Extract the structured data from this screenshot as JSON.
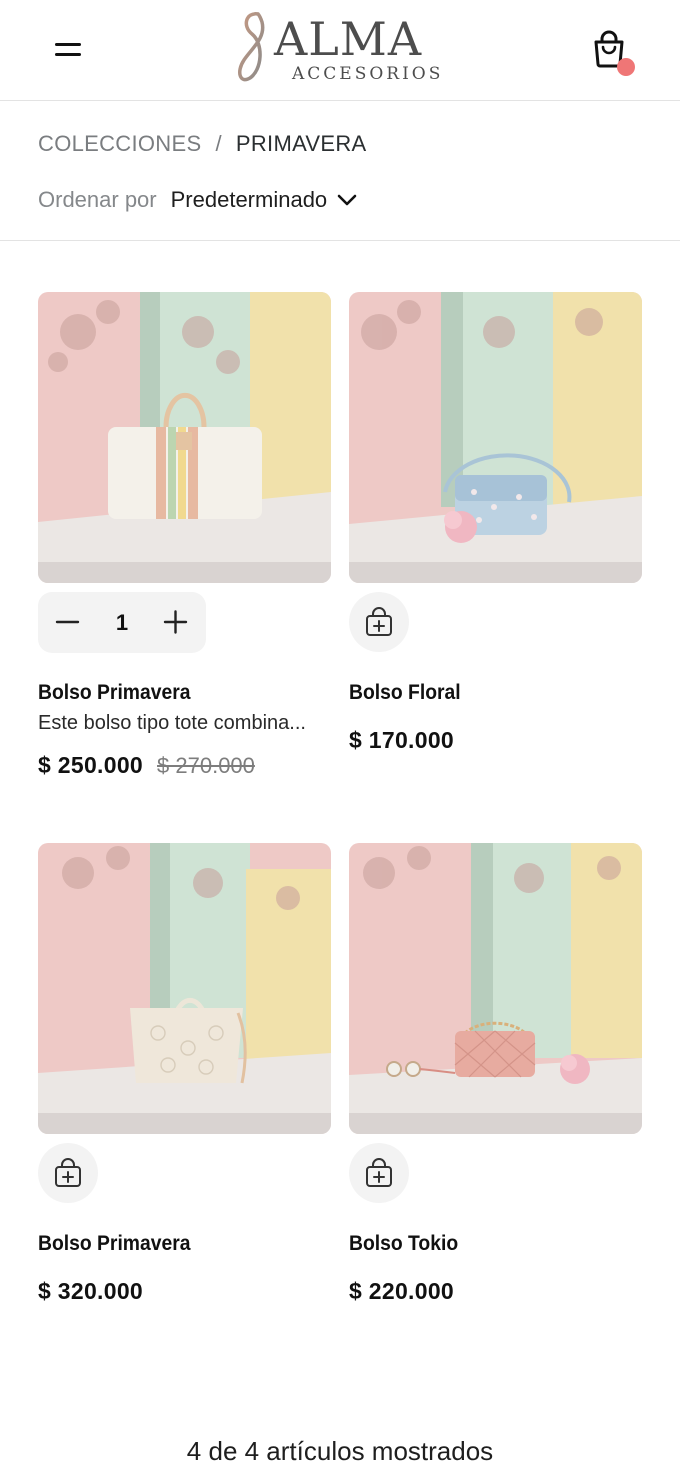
{
  "brand": {
    "name": "ALMA",
    "tagline": "ACCESORIOS",
    "mark_letter": "8"
  },
  "header": {
    "menu_icon": "hamburger-icon",
    "cart_icon": "shopping-bag-icon",
    "cart_badge_color": "#ef7676"
  },
  "breadcrumb": {
    "parent": "COLECCIONES",
    "separator": "/",
    "current": "PRIMAVERA"
  },
  "sort": {
    "label": "Ordenar por",
    "value": "Predeterminado"
  },
  "products": [
    {
      "name": "Bolso Primavera",
      "description": "Este bolso tipo tote combina...",
      "price": "$ 250.000",
      "old_price": "$ 270.000",
      "in_cart": true,
      "quantity": "1"
    },
    {
      "name": "Bolso Floral",
      "price": "$ 170.000",
      "in_cart": false
    },
    {
      "name": "Bolso Primavera",
      "price": "$ 320.000",
      "in_cart": false
    },
    {
      "name": "Bolso Tokio",
      "price": "$ 220.000",
      "in_cart": false
    }
  ],
  "footer": {
    "count_text": "4 de 4 artículos mostrados"
  },
  "colors": {
    "wall_pink": "#eec9c6",
    "wall_mint": "#cfe3d4",
    "wall_yellow": "#f1e1ab",
    "floor": "#ebe7e4",
    "accent": "#ef7676"
  }
}
